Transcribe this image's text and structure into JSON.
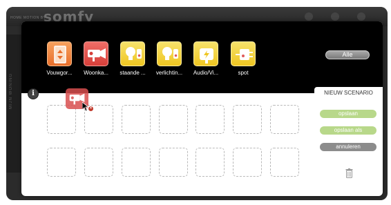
{
  "app": {
    "brand": "somfy",
    "brand_tagline": "HOME MOTION BY",
    "side_tab": "MIJN WONING"
  },
  "devices": [
    {
      "label": "Vouwgor...",
      "type": "blind",
      "color": "#f0823c"
    },
    {
      "label": "Woonka...",
      "type": "camera",
      "color": "#e0524c"
    },
    {
      "label": "staande ...",
      "type": "lamp",
      "color": "#f2d13a"
    },
    {
      "label": "verlichtin...",
      "type": "lamp",
      "color": "#f2d13a"
    },
    {
      "label": "Audio/Vi...",
      "type": "plug-power",
      "color": "#f2d13a"
    },
    {
      "label": "spot",
      "type": "plug",
      "color": "#f2d13a"
    }
  ],
  "filter": {
    "all_label": "Alle"
  },
  "scenario": {
    "tab_label": "NIEUW SCENARIO",
    "save_label": "opslaan",
    "save_as_label": "opslaan als",
    "cancel_label": "annuleren"
  },
  "colors": {
    "accent_green": "#b8d88a",
    "neutral_gray": "#8c8c8c",
    "header_black": "#000000"
  },
  "icons": {
    "info": "info-icon",
    "trash": "trash-icon",
    "no_drop": "no-drop-icon",
    "cursor": "cursor-icon"
  },
  "slots": {
    "rows": 2,
    "columns": 7
  }
}
